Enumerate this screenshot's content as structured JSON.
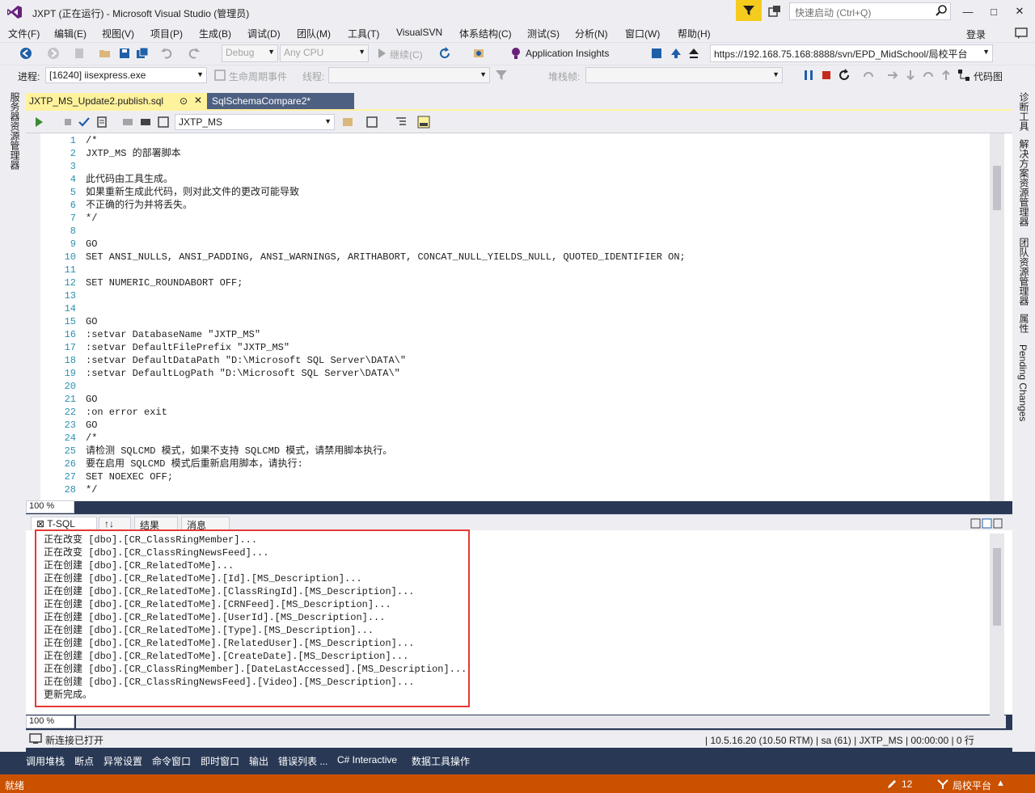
{
  "title_bar": {
    "title": "JXPT (正在运行) - Microsoft Visual Studio (管理员)",
    "quick_launch_placeholder": "快速启动 (Ctrl+Q)"
  },
  "menu": [
    "文件(F)",
    "编辑(E)",
    "视图(V)",
    "项目(P)",
    "生成(B)",
    "调试(D)",
    "团队(M)",
    "工具(T)",
    "VisualSVN",
    "体系结构(C)",
    "测试(S)",
    "分析(N)",
    "窗口(W)",
    "帮助(H)"
  ],
  "login_label": "登录",
  "toolbar1": {
    "configuration": "Debug",
    "platform": "Any CPU",
    "continue_label": "继续(C)",
    "app_insights_label": "Application Insights",
    "svn_url": "https://192.168.75.168:8888/svn/EPD_MidSchool/局校平台"
  },
  "toolbar2": {
    "process_label": "进程:",
    "process_value": "[16240] iisexpress.exe",
    "lifecycle_label": "生命周期事件",
    "thread_label": "线程:",
    "stack_label": "堆栈帧:",
    "code_map_label": "代码图"
  },
  "left_strip": [
    "服务器资源管理器"
  ],
  "right_strip": [
    "诊断工具",
    "解决方案资源管理器",
    "团队资源管理器",
    "属性",
    "Pending Changes"
  ],
  "tabs": {
    "active": "JXTP_MS_Update2.publish.sql",
    "inactive": "SqlSchemaCompare2*"
  },
  "editor": {
    "database": "JXTP_MS",
    "zoom": "100 %",
    "lines": [
      {
        "n": "1",
        "text": "/*"
      },
      {
        "n": "2",
        "text": "JXTP_MS 的部署脚本"
      },
      {
        "n": "3",
        "text": ""
      },
      {
        "n": "4",
        "text": "此代码由工具生成。"
      },
      {
        "n": "5",
        "text": "如果重新生成此代码，则对此文件的更改可能导致"
      },
      {
        "n": "6",
        "text": "不正确的行为并将丢失。"
      },
      {
        "n": "7",
        "text": "*/"
      },
      {
        "n": "8",
        "text": ""
      },
      {
        "n": "9",
        "text": "GO"
      },
      {
        "n": "10",
        "text": "SET ANSI_NULLS, ANSI_PADDING, ANSI_WARNINGS, ARITHABORT, CONCAT_NULL_YIELDS_NULL, QUOTED_IDENTIFIER ON;"
      },
      {
        "n": "11",
        "text": ""
      },
      {
        "n": "12",
        "text": "SET NUMERIC_ROUNDABORT OFF;"
      },
      {
        "n": "13",
        "text": ""
      },
      {
        "n": "14",
        "text": ""
      },
      {
        "n": "15",
        "text": "GO"
      },
      {
        "n": "16",
        "text": ":setvar DatabaseName \"JXTP_MS\""
      },
      {
        "n": "17",
        "text": ":setvar DefaultFilePrefix \"JXTP_MS\""
      },
      {
        "n": "18",
        "text": ":setvar DefaultDataPath \"D:\\Microsoft SQL Server\\DATA\\\""
      },
      {
        "n": "19",
        "text": ":setvar DefaultLogPath \"D:\\Microsoft SQL Server\\DATA\\\""
      },
      {
        "n": "20",
        "text": ""
      },
      {
        "n": "21",
        "text": "GO"
      },
      {
        "n": "22",
        "text": ":on error exit"
      },
      {
        "n": "23",
        "text": "GO"
      },
      {
        "n": "24",
        "text": "/*"
      },
      {
        "n": "25",
        "text": "请检测 SQLCMD 模式，如果不支持 SQLCMD 模式，请禁用脚本执行。"
      },
      {
        "n": "26",
        "text": "要在启用 SQLCMD 模式后重新启用脚本，请执行:"
      },
      {
        "n": "27",
        "text": "SET NOEXEC OFF;"
      },
      {
        "n": "28",
        "text": "*/"
      }
    ]
  },
  "results": {
    "tabs": [
      "T-SQL",
      "↑↓",
      "结果",
      "消息"
    ],
    "zoom": "100 %",
    "messages": [
      "正在改变 [dbo].[CR_ClassRingMember]...",
      "正在改变 [dbo].[CR_ClassRingNewsFeed]...",
      "正在创建 [dbo].[CR_RelatedToMe]...",
      "正在创建 [dbo].[CR_RelatedToMe].[Id].[MS_Description]...",
      "正在创建 [dbo].[CR_RelatedToMe].[ClassRingId].[MS_Description]...",
      "正在创建 [dbo].[CR_RelatedToMe].[CRNFeed].[MS_Description]...",
      "正在创建 [dbo].[CR_RelatedToMe].[UserId].[MS_Description]...",
      "正在创建 [dbo].[CR_RelatedToMe].[Type].[MS_Description]...",
      "正在创建 [dbo].[CR_RelatedToMe].[RelatedUser].[MS_Description]...",
      "正在创建 [dbo].[CR_RelatedToMe].[CreateDate].[MS_Description]...",
      "正在创建 [dbo].[CR_ClassRingMember].[DateLastAccessed].[MS_Description]...",
      "正在创建 [dbo].[CR_ClassRingNewsFeed].[Video].[MS_Description]...",
      "更新完成。"
    ]
  },
  "connection": {
    "status": "新连接已打开",
    "server": "10.5.16.20 (10.50 RTM)",
    "user": "sa (61)",
    "database": "JXTP_MS",
    "time": "00:00:00",
    "rows": "0 行"
  },
  "tool_tabs": [
    "调用堆栈",
    "断点",
    "异常设置",
    "命令窗口",
    "即时窗口",
    "输出",
    "错误列表 ...",
    "C# Interactive",
    "数据工具操作"
  ],
  "status_bar": {
    "ready": "就绪",
    "pending_count": "12",
    "branch": "局校平台"
  },
  "colors": {
    "window_bg": "#293955",
    "chrome": "#eeeef2",
    "active_tab": "#fff29d",
    "status_bar": "#ca5100",
    "highlight_box": "#e53935",
    "line_numbers": "#2b91af"
  }
}
